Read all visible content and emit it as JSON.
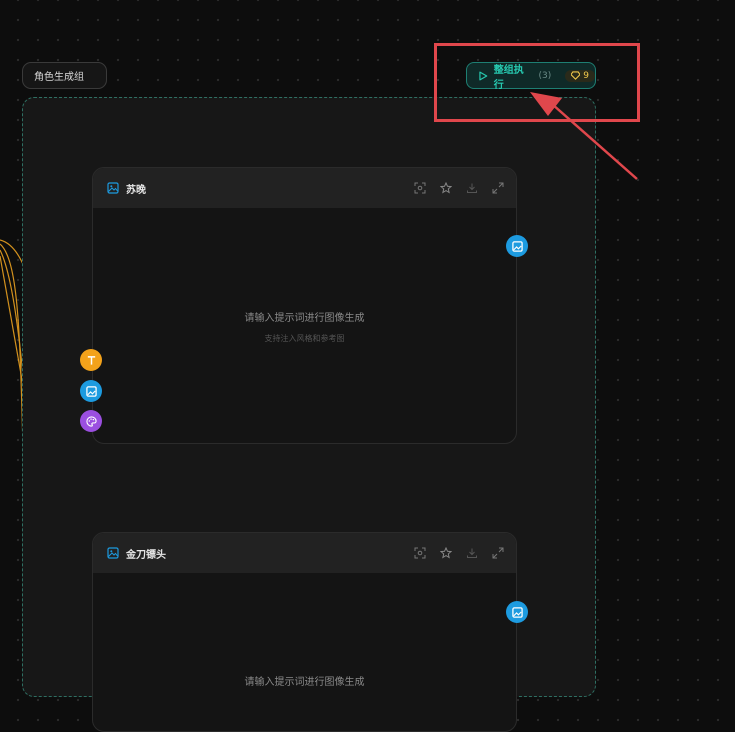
{
  "group": {
    "name": "角色生成组"
  },
  "run_button": {
    "label": "整组执行",
    "count": "(3)",
    "cost": "9"
  },
  "cards": [
    {
      "title": "苏晚",
      "prompt_main": "请输入提示词进行图像生成",
      "prompt_sub": "支持注入风格和参考图"
    },
    {
      "title": "金刀镖头",
      "prompt_main": "请输入提示词进行图像生成"
    }
  ],
  "colors": {
    "accent": "#27c9b0",
    "highlight": "#e0474c",
    "wire": "#e8a020",
    "port_image": "#1d9be0",
    "port_text": "#f3a21b",
    "port_style": "#9b4fe0"
  }
}
